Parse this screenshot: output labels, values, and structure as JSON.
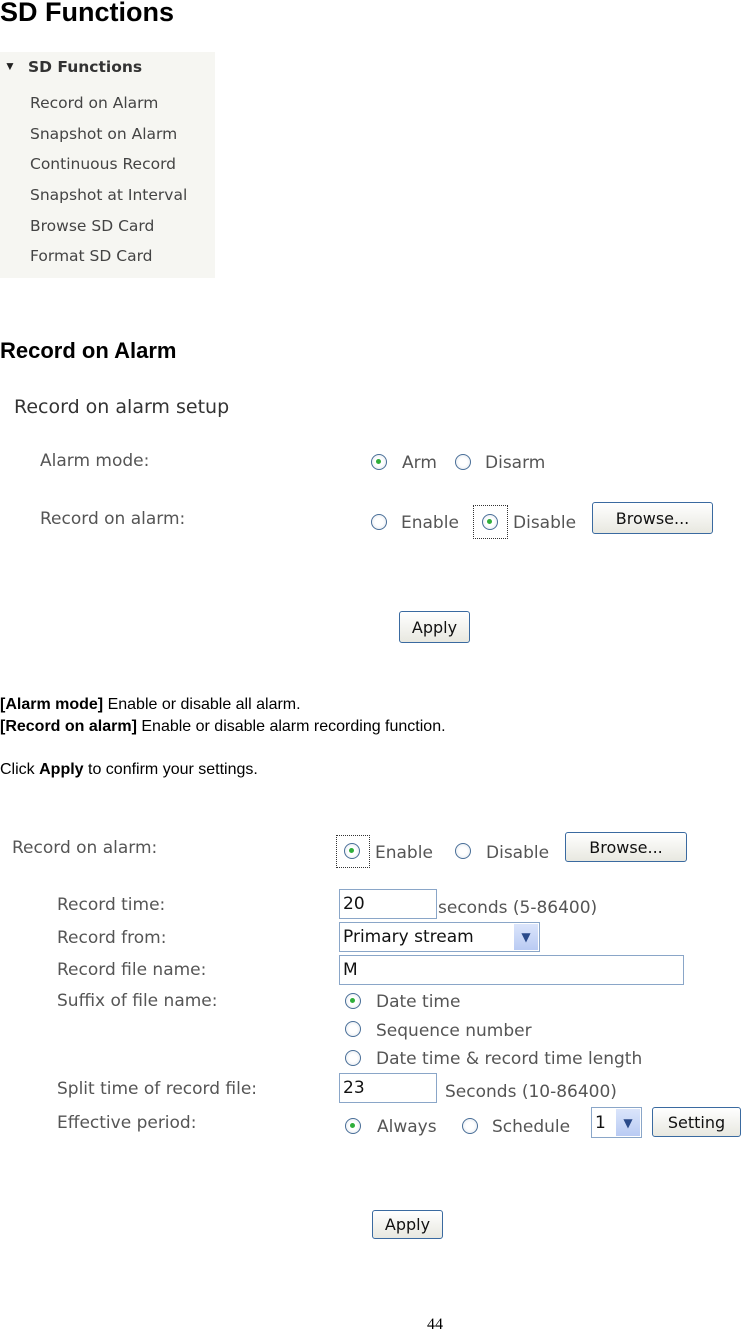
{
  "title": "SD Functions",
  "menu": {
    "header": "SD Functions",
    "items": [
      "Record on Alarm",
      "Snapshot on Alarm",
      "Continuous Record",
      "Snapshot at Interval",
      "Browse SD Card",
      "Format SD Card"
    ]
  },
  "section_title": "Record on Alarm",
  "shot1": {
    "heading": "Record on alarm setup",
    "alarm_mode_label": "Alarm mode:",
    "arm": "Arm",
    "disarm": "Disarm",
    "record_label": "Record on alarm:",
    "enable": "Enable",
    "disable": "Disable",
    "browse": "Browse...",
    "apply": "Apply"
  },
  "desc": {
    "l1_b": "[Alarm mode]",
    "l1": " Enable or disable all alarm.",
    "l2_b": "[Record on alarm]",
    "l2": " Enable or disable alarm recording function.",
    "l3_a": "Click ",
    "l3_b": "Apply",
    "l3_c": " to confirm your settings."
  },
  "shot2": {
    "record_label": "Record on alarm:",
    "enable": "Enable",
    "disable": "Disable",
    "browse": "Browse...",
    "record_time_label": "Record time:",
    "record_time": "20",
    "record_time_unit": "seconds (5-86400)",
    "record_from_label": "Record from:",
    "record_from": "Primary stream",
    "file_name_label": "Record file name:",
    "file_name": "M",
    "suffix_label": "Suffix of file name:",
    "suffix_opts": [
      "Date time",
      "Sequence number",
      "Date time & record time length"
    ],
    "split_label": "Split time of record file:",
    "split": "23",
    "split_unit": "Seconds (10-86400)",
    "period_label": "Effective period:",
    "always": "Always",
    "schedule": "Schedule",
    "schedule_no": "1",
    "setting": "Setting",
    "apply": "Apply"
  },
  "page_number": "44"
}
